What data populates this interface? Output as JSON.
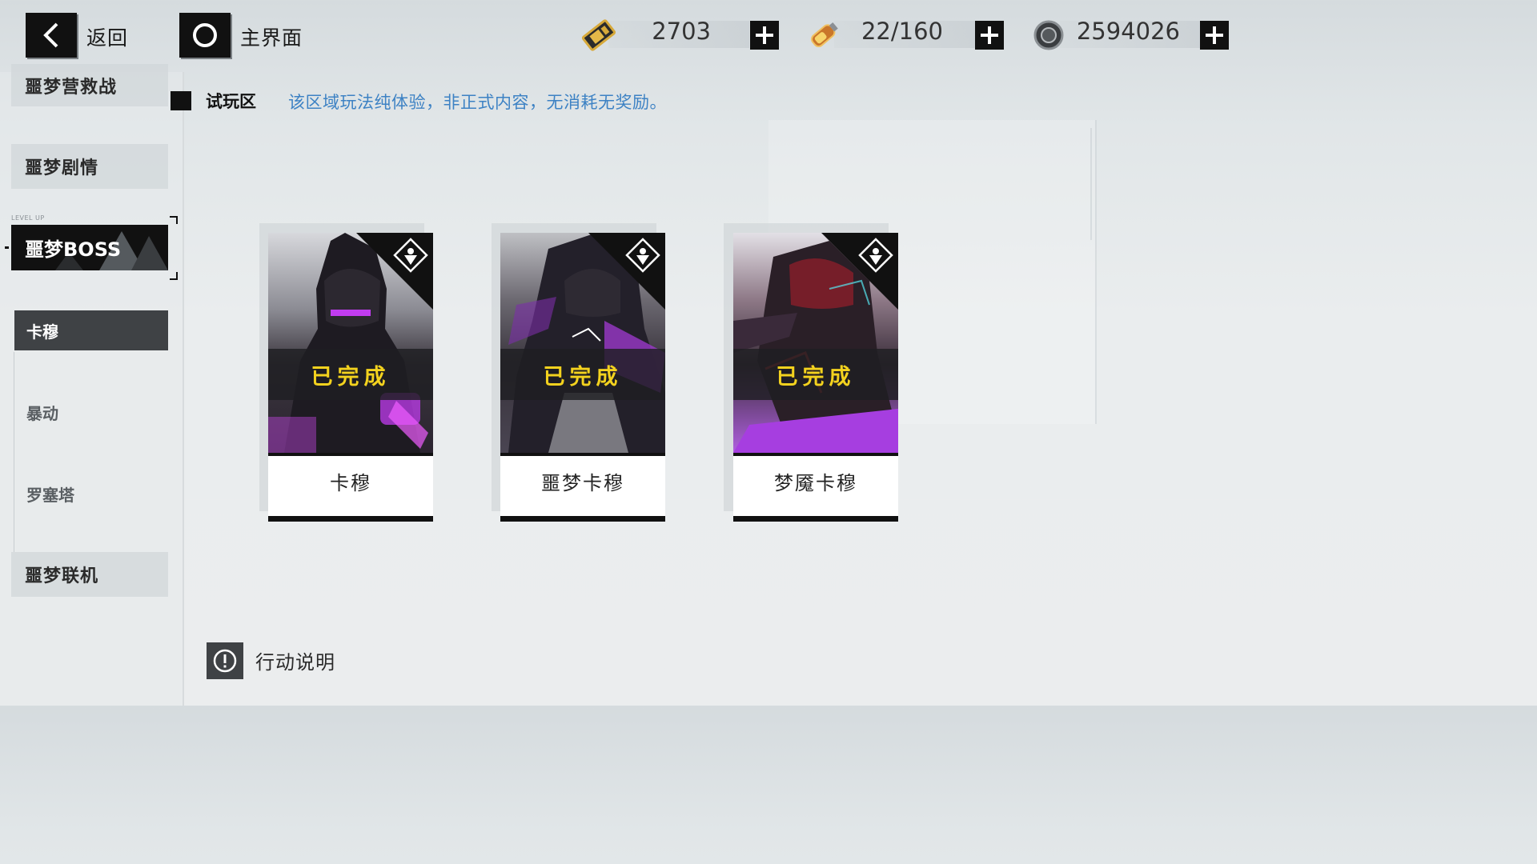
{
  "top_bar": {
    "back_label": "返回",
    "home_label": "主界面",
    "resources": [
      {
        "icon": "gold-ticket-icon",
        "value": "2703"
      },
      {
        "icon": "stamina-vial-icon",
        "value": "22/160"
      },
      {
        "icon": "coin-icon",
        "value": "2594026"
      }
    ]
  },
  "sidebar": {
    "items": [
      {
        "label": "噩梦营救战"
      },
      {
        "label": "噩梦剧情"
      },
      {
        "label": "噩梦BOSS",
        "tag": "LEVEL UP"
      },
      {
        "label": "噩梦联机"
      }
    ],
    "sub_items": [
      {
        "label": "卡穆",
        "active": true
      },
      {
        "label": "暴动"
      },
      {
        "label": "罗塞塔"
      }
    ]
  },
  "main": {
    "section_title": "试玩区",
    "section_desc": "该区域玩法纯体验，非正式内容，无消耗无奖励。",
    "cards": [
      {
        "name": "卡穆",
        "status": "已完成"
      },
      {
        "name": "噩梦卡穆",
        "status": "已完成"
      },
      {
        "name": "梦魇卡穆",
        "status": "已完成"
      }
    ],
    "info_label": "行动说明"
  },
  "colors": {
    "accent_blue": "#3d82c4",
    "status_yellow": "#f3d21e",
    "dark": "#111111"
  }
}
